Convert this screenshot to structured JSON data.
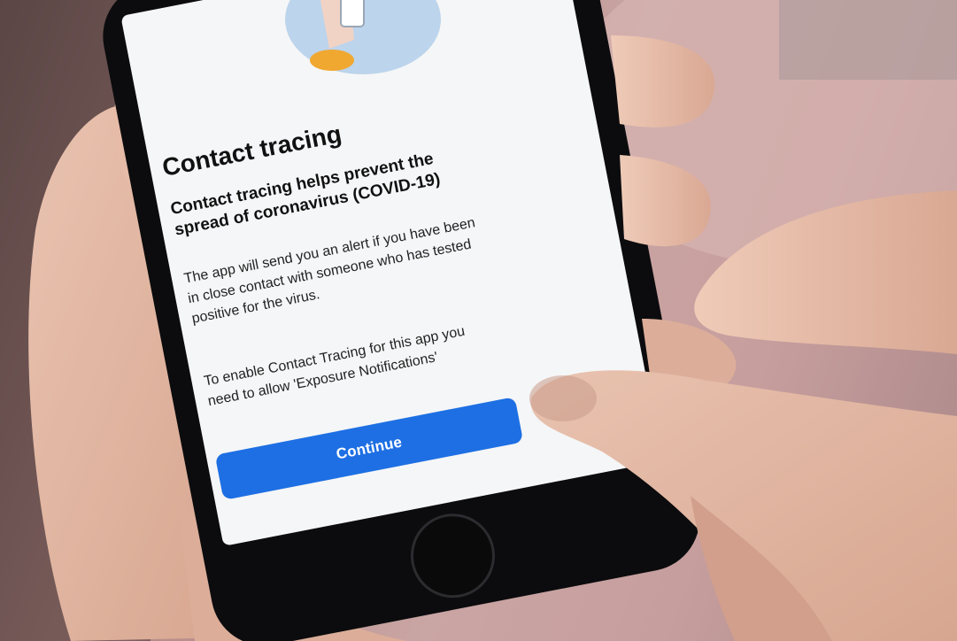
{
  "screen": {
    "title": "Contact tracing",
    "heading": "Contact tracing helps prevent the spread of coronavirus (COVID-19)",
    "body_1": "The app will send you an alert if you have been in close contact with someone who has tested positive for the virus.",
    "body_2": "To enable Contact Tracing for this app you need to allow 'Exposure Notifications'",
    "continue_label": "Continue"
  },
  "colors": {
    "button": "#1e6fe3",
    "phone_body": "#0c0c0e",
    "screen": "#f5f6f7",
    "illustration": "#bcd4ec",
    "illustration_accent": "#f0a830",
    "background": "#c9a5a3"
  },
  "icons": [
    "home-button-icon"
  ]
}
